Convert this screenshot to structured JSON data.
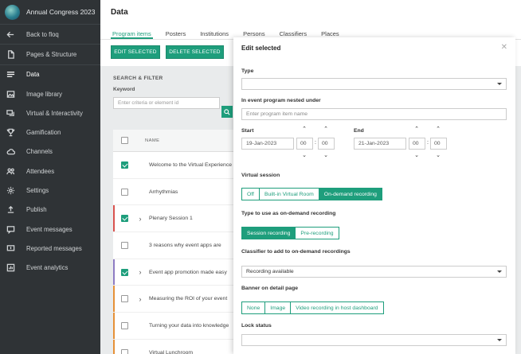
{
  "app": {
    "title": "Annual Congress 2023"
  },
  "sidebar": {
    "items": [
      {
        "label": "Back to floq",
        "icon": "arrow-left-icon"
      },
      {
        "label": "Pages & Structure",
        "icon": "page-icon"
      },
      {
        "label": "Data",
        "icon": "list-icon",
        "active": true
      },
      {
        "label": "Image library",
        "icon": "image-icon"
      },
      {
        "label": "Virtual & Interactivity",
        "icon": "chat-icon"
      },
      {
        "label": "Gamification",
        "icon": "trophy-icon"
      },
      {
        "label": "Channels",
        "icon": "cloud-icon"
      },
      {
        "label": "Attendees",
        "icon": "people-icon"
      },
      {
        "label": "Settings",
        "icon": "gear-icon"
      },
      {
        "label": "Publish",
        "icon": "upload-icon"
      },
      {
        "label": "Event messages",
        "icon": "message-icon"
      },
      {
        "label": "Reported messages",
        "icon": "report-icon"
      },
      {
        "label": "Event analytics",
        "icon": "analytics-icon"
      }
    ]
  },
  "main": {
    "title": "Data",
    "tabs": [
      "Program items",
      "Posters",
      "Institutions",
      "Persons",
      "Classifiers",
      "Places"
    ],
    "edit_selected_btn": "EDIT SELECTED",
    "delete_selected_btn": "DELETE SELECTED",
    "filter": {
      "title": "SEARCH & FILTER",
      "keyword_label": "Keyword",
      "keyword_placeholder": "Enter criteria or element id"
    },
    "table": {
      "name_header": "NAME",
      "rows": [
        {
          "name": "Welcome to the Virtual Experience",
          "checked": true,
          "expand": false,
          "bar": ""
        },
        {
          "name": "Arrhythmias",
          "checked": false,
          "expand": false,
          "bar": ""
        },
        {
          "name": "Plenary Session 1",
          "checked": true,
          "expand": true,
          "bar": "#d9534f"
        },
        {
          "name": "3 reasons why event apps are",
          "checked": false,
          "expand": false,
          "bar": ""
        },
        {
          "name": "Event app promotion made easy",
          "checked": true,
          "expand": true,
          "bar": "#8e7cc3"
        },
        {
          "name": "Measuring the ROI of your event",
          "checked": false,
          "expand": true,
          "bar": "#e69138"
        },
        {
          "name": "Turning your data into knowledge",
          "checked": false,
          "expand": false,
          "bar": "#e69138"
        },
        {
          "name": "Virtual Lunchroom",
          "checked": false,
          "expand": false,
          "bar": "#e69138"
        }
      ]
    }
  },
  "panel": {
    "title": "Edit selected",
    "type_label": "Type",
    "type_value": "",
    "nested_label": "In event program nested under",
    "nested_placeholder": "Enter program item name",
    "start_label": "Start",
    "start_date": "19-Jan-2023",
    "start_hour": "00",
    "start_min": "00",
    "end_label": "End",
    "end_date": "21-Jan-2023",
    "end_hour": "00",
    "end_min": "00",
    "virtual_label": "Virtual session",
    "virtual_options": [
      "Off",
      "Built-in Virtual Room",
      "On-demand recording"
    ],
    "virtual_selected": 2,
    "ondemand_type_label": "Type to use as on-demand recording",
    "ondemand_options": [
      "Session recording",
      "Pre-recording"
    ],
    "ondemand_selected": 0,
    "classifier_label": "Classifier to add to on-demand recordings",
    "classifier_value": "Recording available",
    "banner_label": "Banner on detail page",
    "banner_options": [
      "None",
      "Image",
      "Video recording in host dashboard"
    ],
    "banner_selected": -1,
    "lock_label": "Lock status",
    "lock_value": ""
  },
  "colors": {
    "accent": "#1e9e7c",
    "sidebar_bg": "#2f3336"
  }
}
